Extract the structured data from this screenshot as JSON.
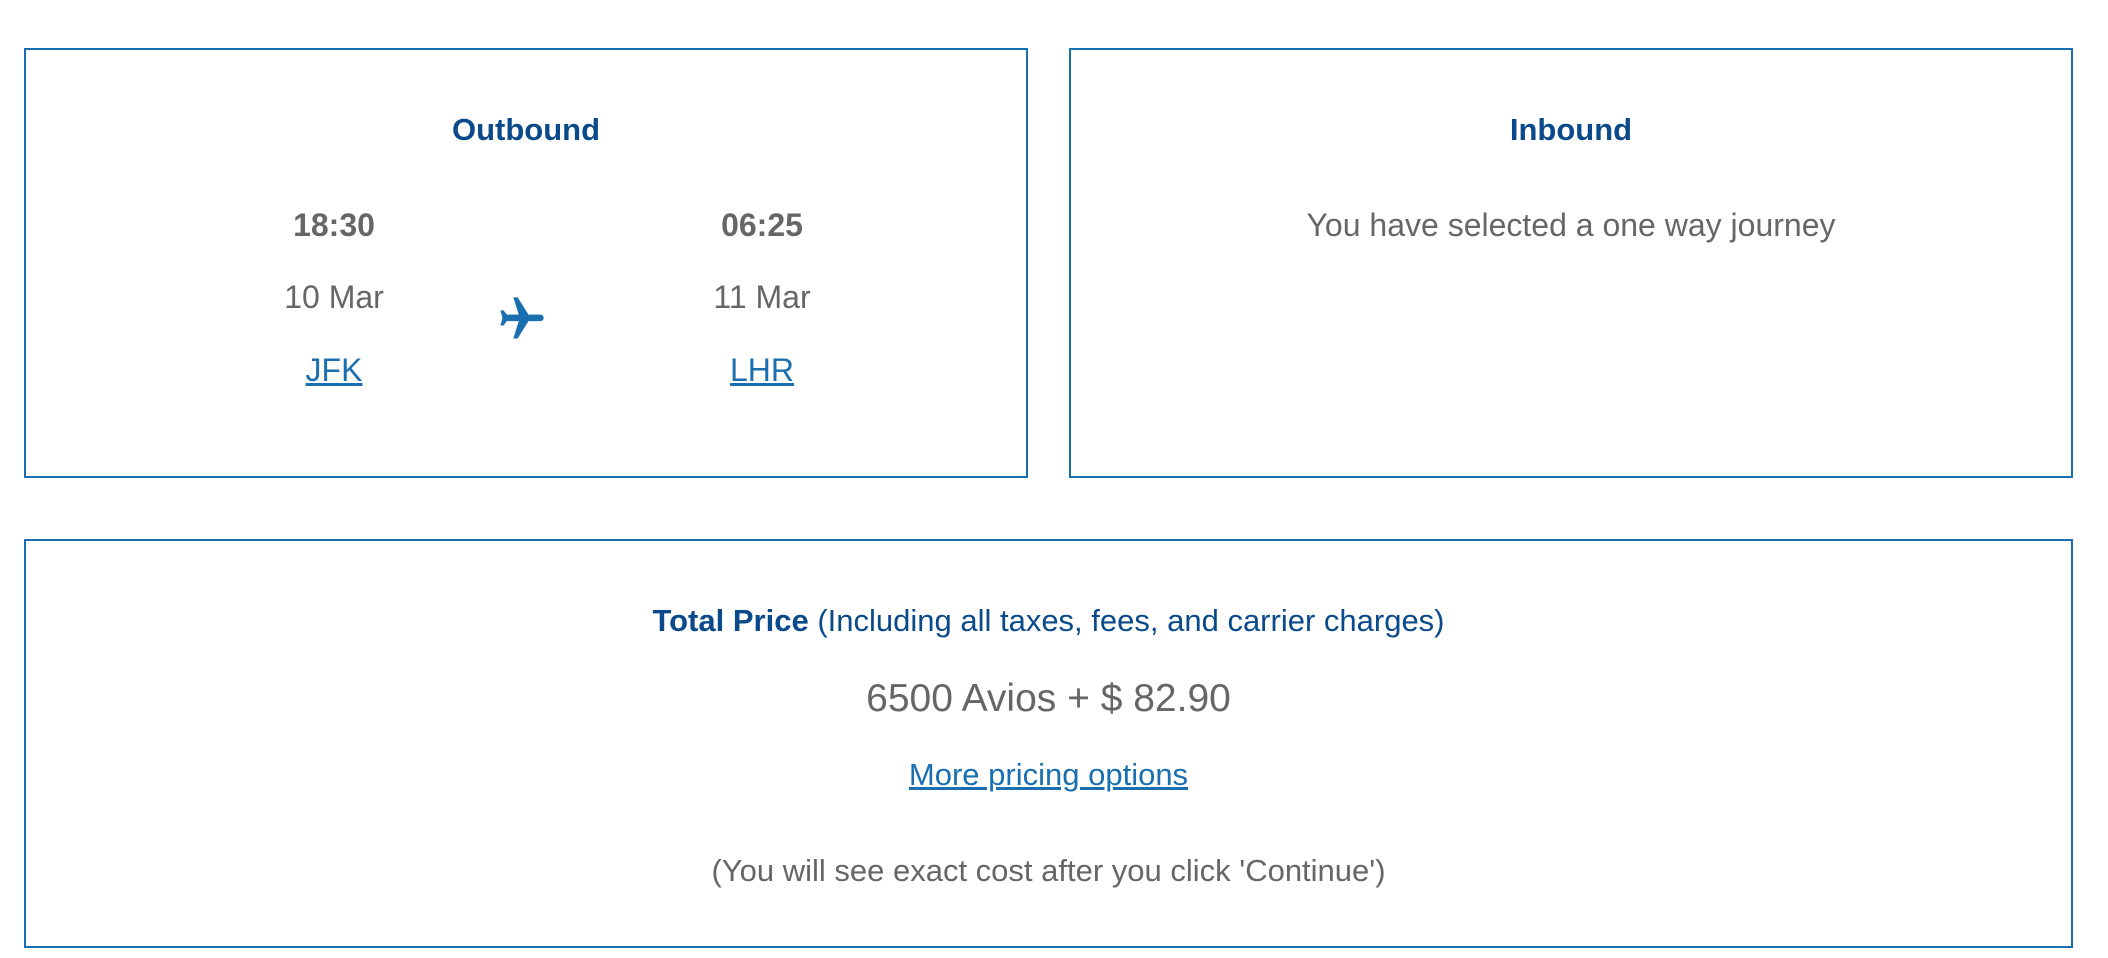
{
  "outbound": {
    "title": "Outbound",
    "departure": {
      "time": "18:30",
      "date": "10 Mar",
      "airport": "JFK"
    },
    "arrival": {
      "time": "06:25",
      "date": "11 Mar",
      "airport": "LHR"
    },
    "icon": "airplane-icon"
  },
  "inbound": {
    "title": "Inbound",
    "message": "You have selected a one way journey"
  },
  "price": {
    "heading_bold": "Total Price",
    "heading_note": "(Including all taxes, fees, and carrier charges)",
    "amount": "6500 Avios + $ 82.90",
    "options_link": "More pricing options",
    "note": "(You will see exact cost after you click 'Continue')"
  },
  "colors": {
    "border": "#1a6fb0",
    "heading": "#0a4a8a",
    "link": "#1a6fb0",
    "text": "#666666"
  }
}
